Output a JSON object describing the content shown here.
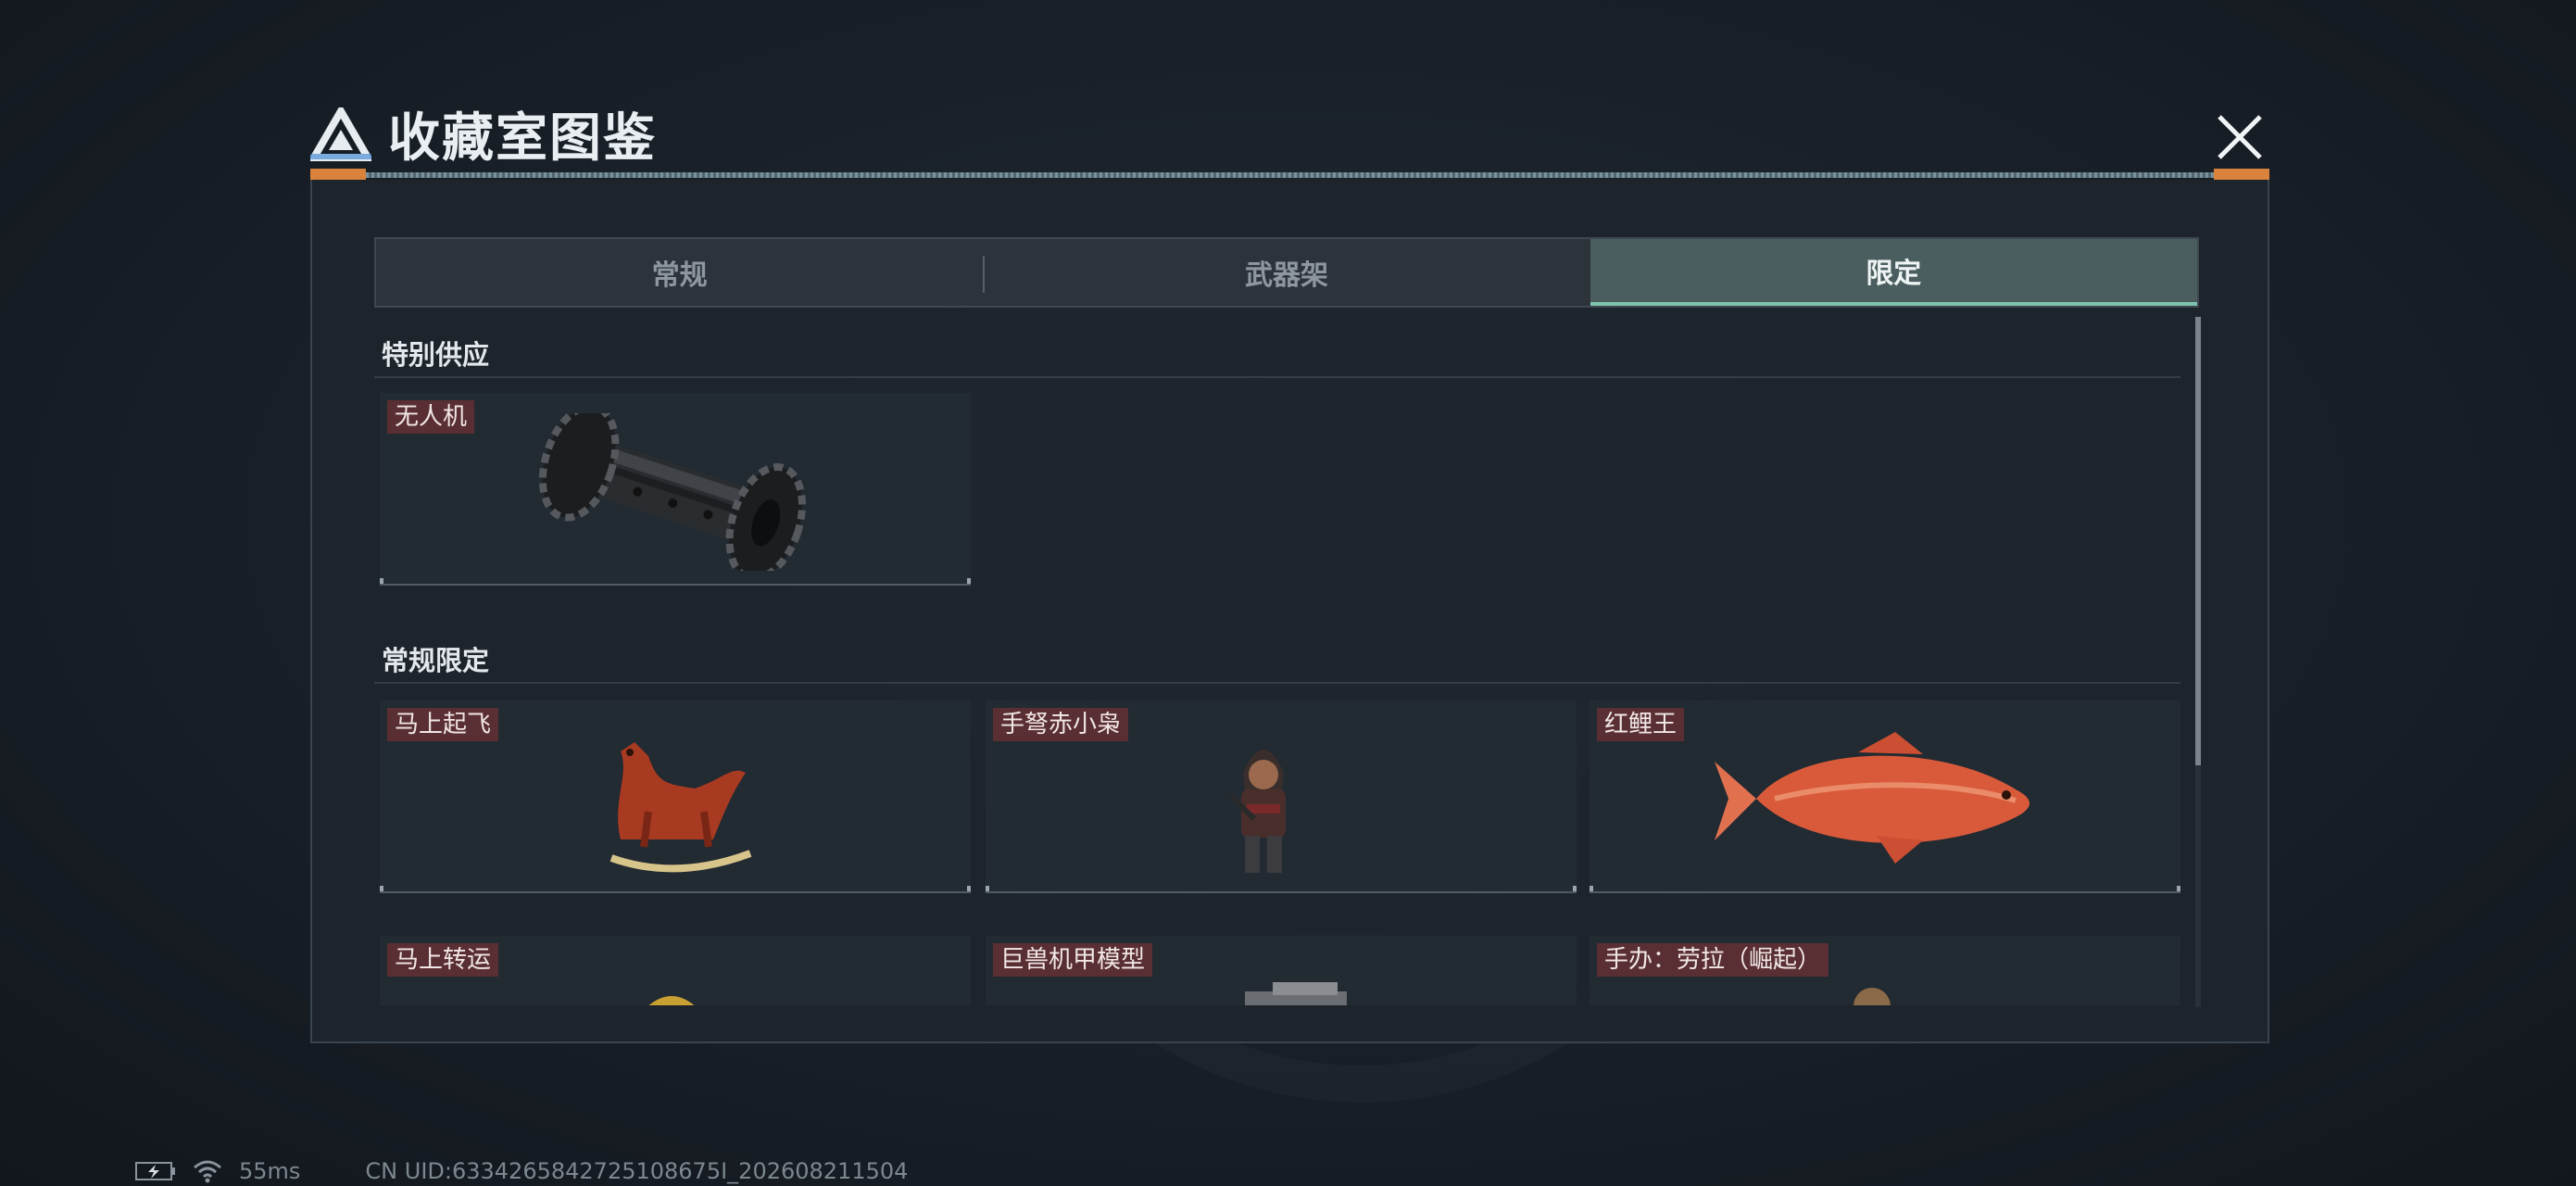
{
  "window": {
    "title": "收藏室图鉴",
    "close_icon": "close-icon"
  },
  "tabs": [
    {
      "label": "常规",
      "active": false
    },
    {
      "label": "武器架",
      "active": false
    },
    {
      "label": "限定",
      "active": true
    }
  ],
  "sections": [
    {
      "title": "特别供应",
      "items": [
        {
          "label": "无人机",
          "icon": "drone-item"
        }
      ]
    },
    {
      "title": "常规限定",
      "items": [
        {
          "label": "马上起飞",
          "icon": "rocking-horse-item"
        },
        {
          "label": "手弩赤小枭",
          "icon": "hooded-figure-item"
        },
        {
          "label": "红鲤王",
          "icon": "red-carp-item"
        },
        {
          "label": "马上转运",
          "icon": "gold-horse-item"
        },
        {
          "label": "巨兽机甲模型",
          "icon": "mech-model-item"
        },
        {
          "label": "手办：劳拉（崛起）",
          "icon": "figure-item"
        }
      ]
    }
  ],
  "colors": {
    "accent": "#7fc3ad",
    "label_bg": "#5a2f33",
    "title_accent": "#d9823b"
  },
  "status_bar": {
    "ping": "55ms",
    "uid": "CN UID:6334265842725108675I_202608211504"
  }
}
